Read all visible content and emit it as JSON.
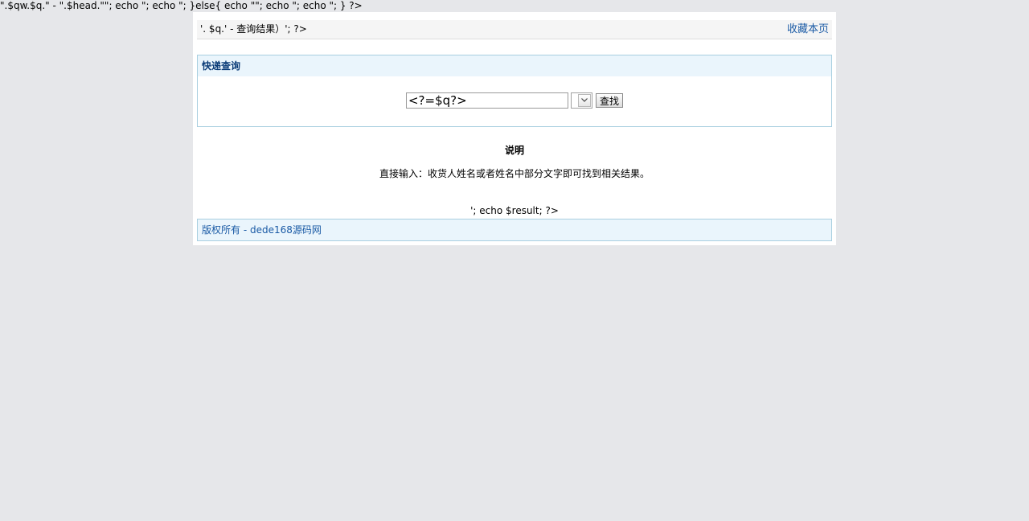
{
  "raw_header_text": "\".$qw.$q.\" - \".$head.\"\"; echo \"; echo \"; }else{ echo \"\"; echo \"; echo \"; } ?>",
  "topbar": {
    "title": "'. $q.' - 查询结果）'; ?>",
    "favorite_link": "收藏本页"
  },
  "query_panel": {
    "heading": "快递查询",
    "search_input_value": "<?=$q?>",
    "select_value": "",
    "search_button": "查找"
  },
  "description": {
    "title": "说明",
    "text": "直接输入：收货人姓名或者姓名中部分文字即可找到相关结果。"
  },
  "result_echo": "'; echo $result; ?>",
  "footer": {
    "copyright": "版权所有 - dede168源码网"
  },
  "colors": {
    "page_background": "#e6e7ea",
    "panel_border": "#a9cfe0",
    "panel_header_bg": "#eaf5fc",
    "link_color": "#1a5aa5",
    "heading_color": "#0b3c78"
  }
}
